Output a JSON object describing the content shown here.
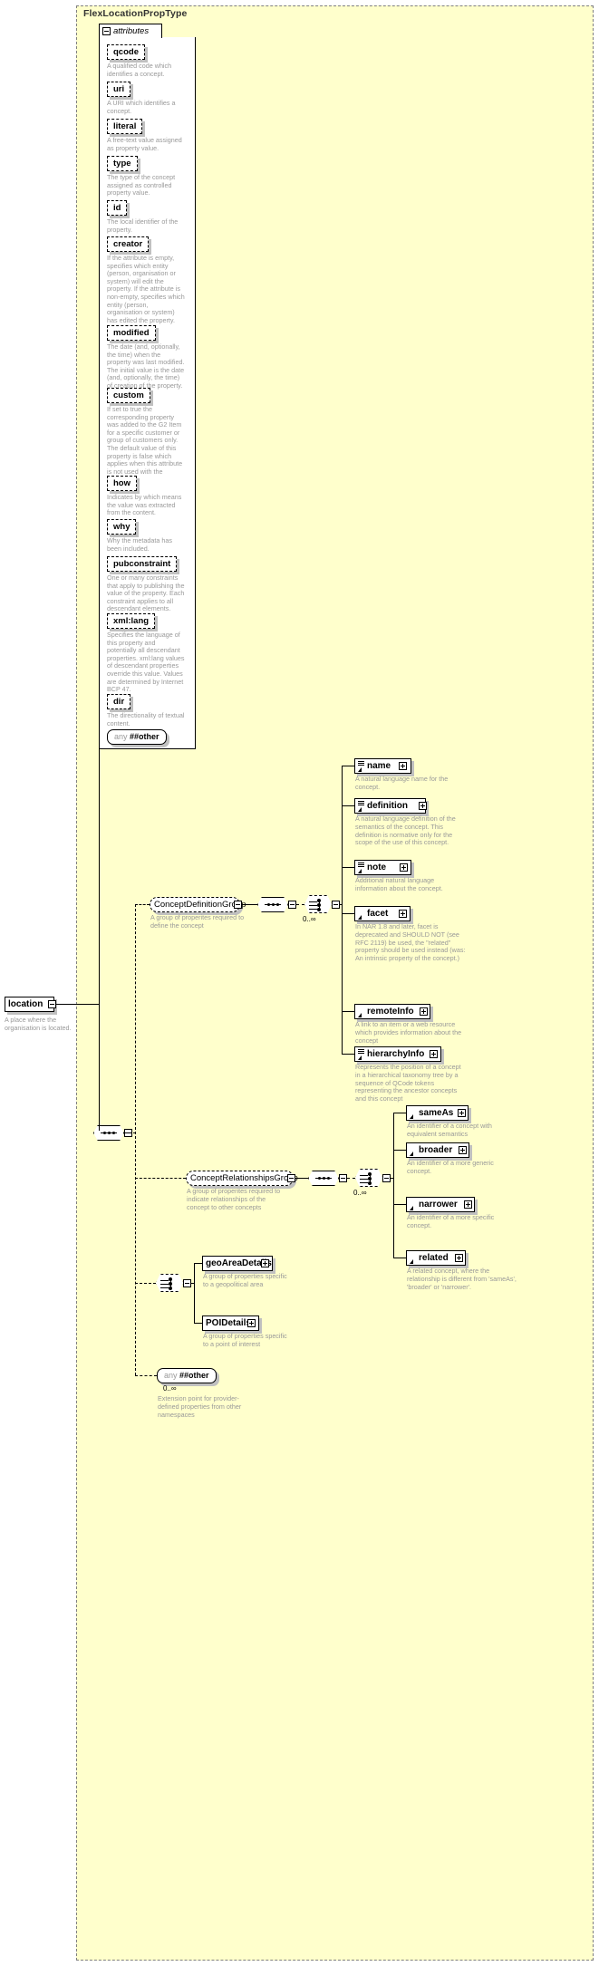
{
  "diagram": {
    "type_name": "FlexLocationPropType",
    "attributes_label": "attributes",
    "root_element": {
      "name": "location",
      "doc": "A place where the organisation is located."
    },
    "any_other_attr": {
      "ns": "any",
      "name": "##other"
    }
  },
  "attributes": [
    {
      "name": "qcode",
      "doc": "A qualified code which identifies a concept."
    },
    {
      "name": "uri",
      "doc": "A URI which identifies a concept."
    },
    {
      "name": "literal",
      "doc": "A free-text value assigned as property value."
    },
    {
      "name": "type",
      "doc": "The type of the concept assigned as controlled property value."
    },
    {
      "name": "id",
      "doc": "The local identifier of the property."
    },
    {
      "name": "creator",
      "doc": "If the attribute is empty, specifies which entity (person, organisation or system) will edit the property. If the attribute is non-empty, specifies which entity (person, organisation or system) has edited the property."
    },
    {
      "name": "modified",
      "doc": "The date (and, optionally, the time) when the property was last modified. The initial value is the date (and, optionally, the time) of creation of the property."
    },
    {
      "name": "custom",
      "doc": "If set to true the corresponding property was added to the G2 Item for a specific customer or group of customers only. The default value of this property is false which applies when this attribute is not used with the property."
    },
    {
      "name": "how",
      "doc": "Indicates by which means the value was extracted from the content."
    },
    {
      "name": "why",
      "doc": "Why the metadata has been included."
    },
    {
      "name": "pubconstraint",
      "doc": "One or many constraints that apply to publishing the value of the property. Each constraint applies to all descendant elements."
    },
    {
      "name": "xml:lang",
      "doc": "Specifies the language of this property and potentially all descendant properties. xml:lang values of descendant properties override this value. Values are determined by Internet BCP 47."
    },
    {
      "name": "dir",
      "doc": "The directionality of textual content."
    }
  ],
  "groups": [
    {
      "name": "ConceptDefinitionGroup",
      "doc": "A group of properites required to define the concept",
      "cardinality": "0..∞",
      "elements": [
        {
          "name": "name",
          "doc": "A natural language name for the concept."
        },
        {
          "name": "definition",
          "doc": "A natural language definition of the semantics of the concept. This definition is normative only for the scope of the use of this concept."
        },
        {
          "name": "note",
          "doc": "Additional natural language information about the concept."
        },
        {
          "name": "facet",
          "doc": "In NAR 1.8 and later, facet is deprecated and SHOULD NOT (see RFC 2119) be used, the \"related\" property should be used instead (was: An intrinsic property of the concept.)"
        },
        {
          "name": "remoteInfo",
          "doc": "A link to an item or a web resource which provides information about the concept"
        },
        {
          "name": "hierarchyInfo",
          "doc": "Represents the position of a concept in a hierarchical taxonomy tree by a sequence of QCode tokens representing the ancestor concepts and this concept"
        }
      ]
    },
    {
      "name": "ConceptRelationshipsGroup",
      "doc": "A group of properites required to indicate relationships of the concept to other concepts",
      "cardinality": "0..∞",
      "elements": [
        {
          "name": "sameAs",
          "doc": "An identifier of a concept with equivalent semantics"
        },
        {
          "name": "broader",
          "doc": "An identifier of a more generic concept."
        },
        {
          "name": "narrower",
          "doc": "An identifier of a more specific concept."
        },
        {
          "name": "related",
          "doc": "A related concept, where the relationship is different from 'sameAs', 'broader' or 'narrower'."
        }
      ]
    }
  ],
  "detail_choice": {
    "elements": [
      {
        "name": "geoAreaDetails",
        "doc": "A group of properties specific to a geopolitical area"
      },
      {
        "name": "POIDetails",
        "doc": "A group of properties specific to a point of interest"
      }
    ]
  },
  "extension": {
    "ns": "any",
    "name": "##other",
    "cardinality": "0..∞",
    "doc": "Extension point for provider-defined properties from other namespaces"
  }
}
